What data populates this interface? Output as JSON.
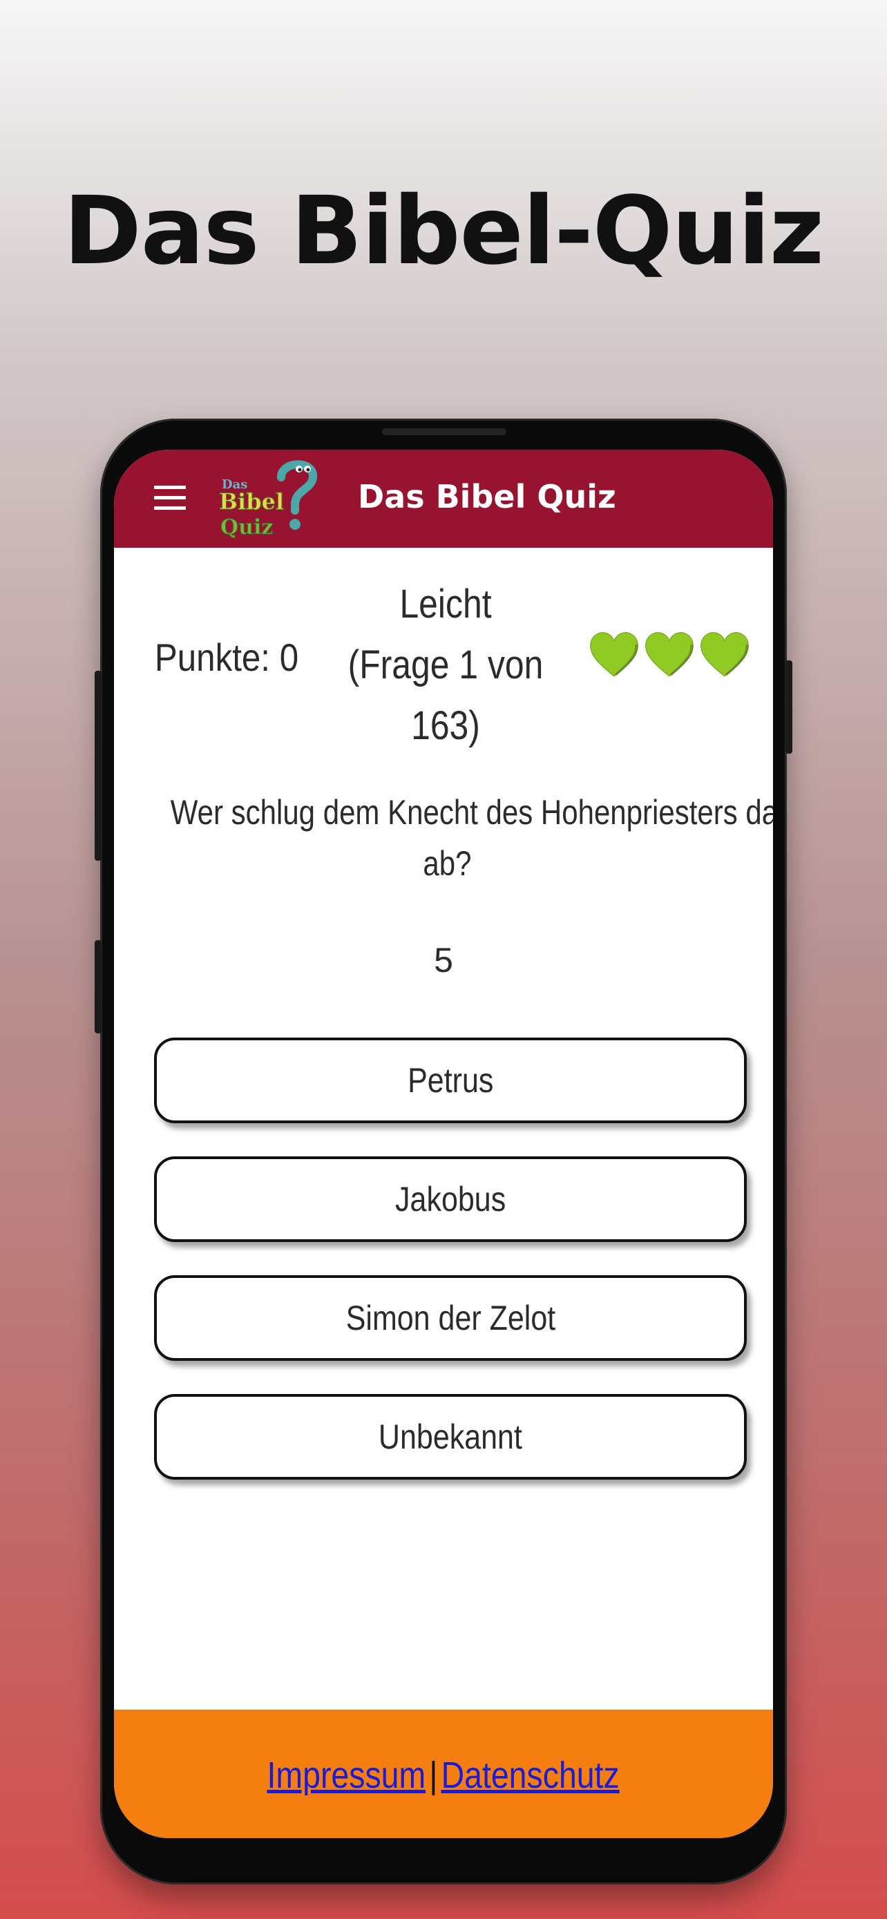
{
  "hero": {
    "title": "Das Bibel-Quiz"
  },
  "app_bar": {
    "menu_icon": "hamburger-menu-icon",
    "logo_text": [
      "Das",
      "Bibel",
      "Quiz"
    ],
    "title": "Das Bibel Quiz",
    "color": "#98132f"
  },
  "status": {
    "score": "Punkte: 0",
    "level": "Leicht",
    "progress_line1": "(Frage 1 von",
    "progress_line2": "163)",
    "lives": 3,
    "heart_icon": "green-heart-icon",
    "heart_color": "#8fcb23"
  },
  "question": {
    "line1": "Wer schlug dem Knecht des Hohenpriesters das Ohr",
    "line2": "ab?",
    "timer": "5"
  },
  "answers": [
    {
      "label": "Petrus"
    },
    {
      "label": "Jakobus"
    },
    {
      "label": "Simon der Zelot"
    },
    {
      "label": "Unbekannt"
    }
  ],
  "footer": {
    "impressum": "Impressum",
    "separator": "|",
    "datenschutz": "Datenschutz",
    "color": "#f47e10"
  }
}
